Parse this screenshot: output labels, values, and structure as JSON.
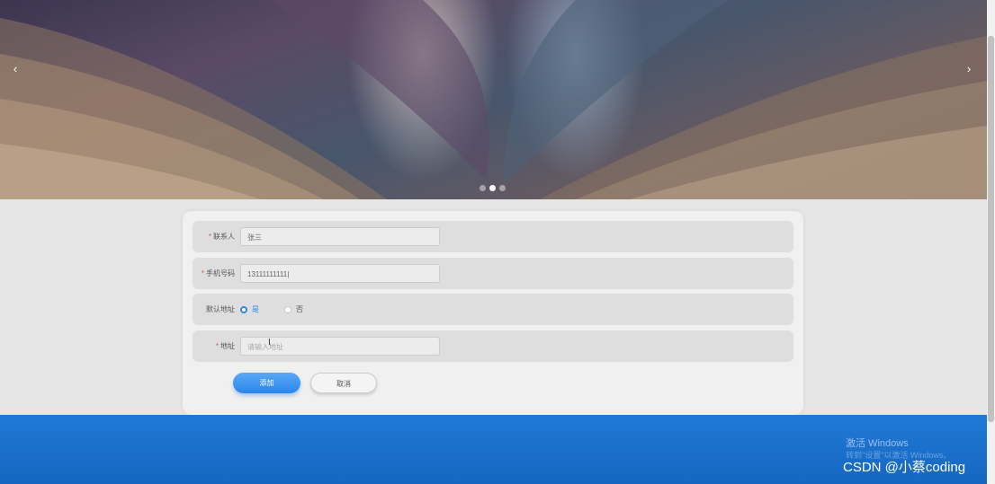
{
  "carousel": {
    "prev_icon": "‹",
    "next_icon": "›",
    "dots": 3,
    "active_dot": 1
  },
  "form": {
    "contact": {
      "label": "联系人",
      "value": "张三"
    },
    "phone": {
      "label": "手机号码",
      "value": "13111111111|"
    },
    "default_address": {
      "label": "默认地址",
      "options": [
        "是",
        "否"
      ],
      "selected": "是"
    },
    "address": {
      "label": "地址",
      "placeholder": "请输入地址"
    },
    "add_button": "添加",
    "cancel_button": "取消"
  },
  "overlay": {
    "windows_line1": "激活 Windows",
    "windows_line2": "转到\"设置\"以激活 Windows。",
    "csdn": "CSDN @小蔡coding"
  },
  "colors": {
    "accent": "#2b88e9",
    "footer": "#1f7ad6",
    "required": "#e05050"
  }
}
